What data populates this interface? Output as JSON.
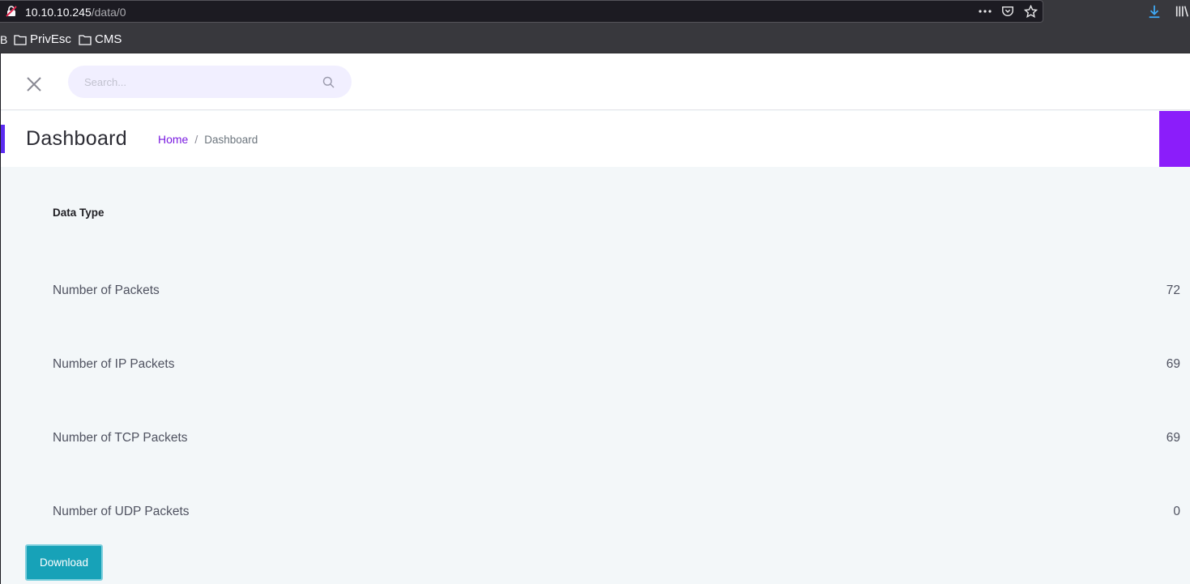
{
  "browser": {
    "url_host": "10.10.10.245",
    "url_path": "/data/0",
    "bookmark_partial": "B",
    "bookmarks": [
      {
        "label": "PrivEsc"
      },
      {
        "label": "CMS"
      }
    ]
  },
  "topbar": {
    "search_placeholder": "Search..."
  },
  "header": {
    "title": "Dashboard",
    "breadcrumb": {
      "home": "Home",
      "separator": "/",
      "current": "Dashboard"
    }
  },
  "table": {
    "header": "Data Type",
    "rows": [
      {
        "label": "Number of Packets",
        "value": "72"
      },
      {
        "label": "Number of IP Packets",
        "value": "69"
      },
      {
        "label": "Number of TCP Packets",
        "value": "69"
      },
      {
        "label": "Number of UDP Packets",
        "value": "0"
      }
    ]
  },
  "actions": {
    "download_label": "Download"
  },
  "colors": {
    "accent_purple": "#8b1dfa",
    "link_purple": "#7a1be0",
    "button_teal": "#17a2b8"
  }
}
